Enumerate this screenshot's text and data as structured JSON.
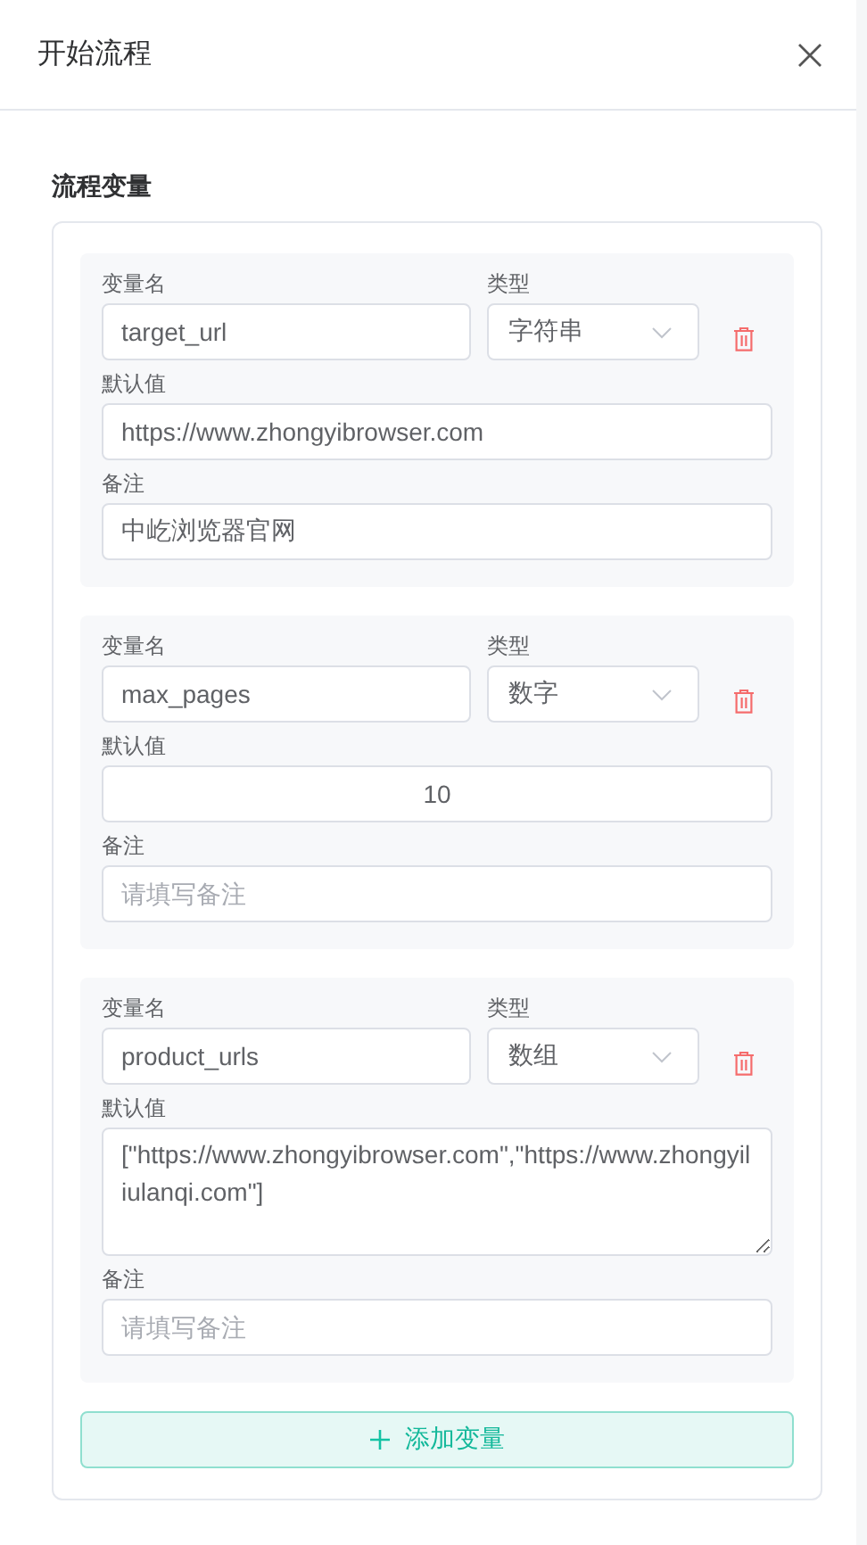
{
  "dialog": {
    "title": "开始流程"
  },
  "section_title": "流程变量",
  "variables": [
    {
      "name_label": "变量名",
      "name": "target_url",
      "type_label": "类型",
      "type": "字符串",
      "default_label": "默认值",
      "default": {
        "kind": "text",
        "value": "https://www.zhongyibrowser.com"
      },
      "note_label": "备注",
      "note": {
        "value": "中屹浏览器官网"
      }
    },
    {
      "name_label": "变量名",
      "name": "max_pages",
      "type_label": "类型",
      "type": "数字",
      "default_label": "默认值",
      "default": {
        "kind": "number",
        "value": "10"
      },
      "note_label": "备注",
      "note": {
        "placeholder": "请填写备注"
      }
    },
    {
      "name_label": "变量名",
      "name": "product_urls",
      "type_label": "类型",
      "type": "数组",
      "default_label": "默认值",
      "default": {
        "kind": "textarea",
        "value": "[\"https://www.zhongyibrowser.com\",\"https://www.zhongyiliulanqi.com\"]"
      },
      "note_label": "备注",
      "note": {
        "placeholder": "请填写备注"
      }
    }
  ],
  "add_button": "添加变量"
}
